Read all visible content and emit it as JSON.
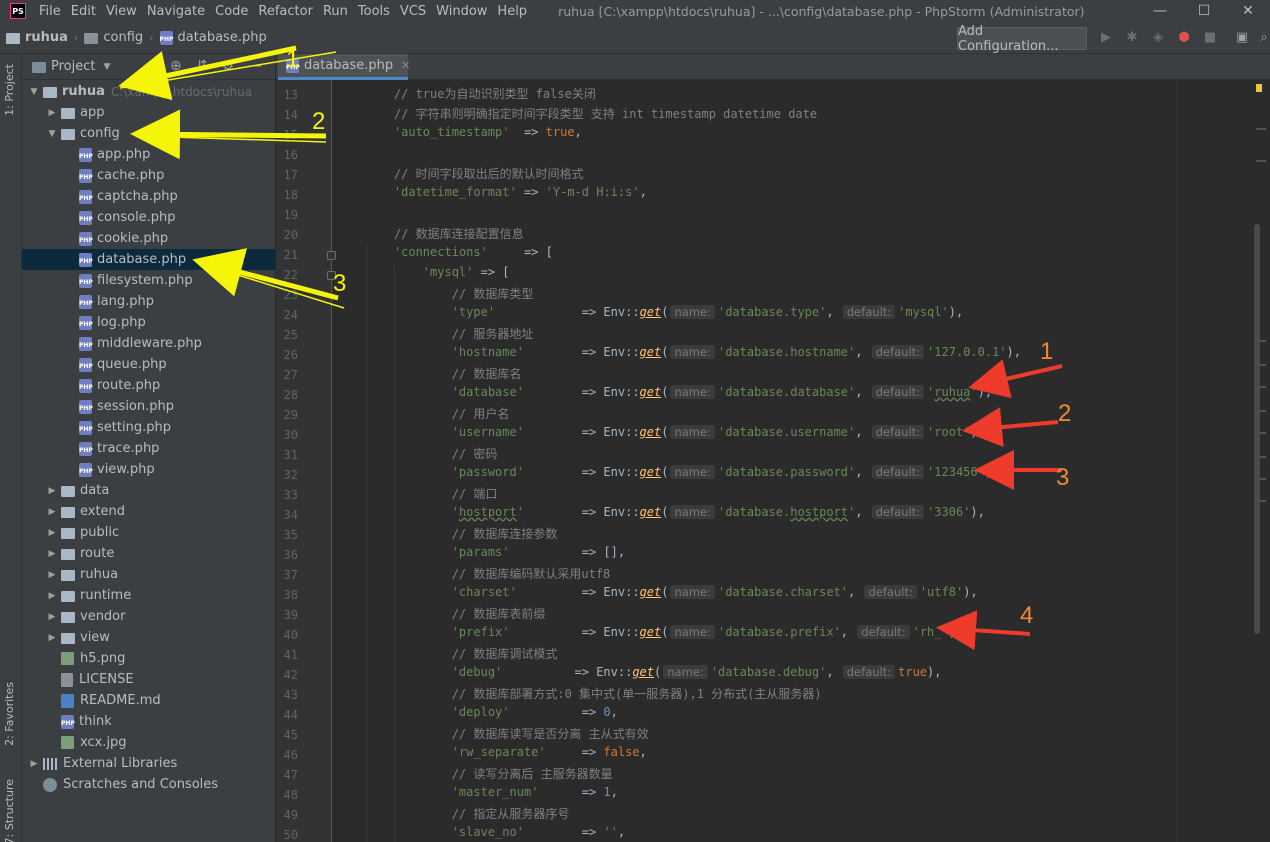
{
  "window": {
    "title": "ruhua [C:\\xampp\\htdocs\\ruhua] - ...\\config\\database.php - PhpStorm (Administrator)",
    "app_logo": "PS",
    "controls": [
      "—",
      "☐",
      "✕"
    ]
  },
  "menu": [
    "File",
    "Edit",
    "View",
    "Navigate",
    "Code",
    "Refactor",
    "Run",
    "Tools",
    "VCS",
    "Window",
    "Help"
  ],
  "breadcrumb": [
    "ruhua",
    "config",
    "database.php"
  ],
  "toolbar": {
    "add_configuration": "Add Configuration..."
  },
  "side_labels": {
    "project": "1: Project",
    "favorites": "2: Favorites",
    "structure": "7: Structure"
  },
  "project_panel": {
    "title": "Project",
    "tree": [
      {
        "label": "ruhua",
        "path": "C:\\xampp\\htdocs\\ruhua",
        "kind": "folder",
        "depth": 0,
        "expanded": true
      },
      {
        "label": "app",
        "kind": "folder",
        "depth": 1,
        "expanded": false
      },
      {
        "label": "config",
        "kind": "folder",
        "depth": 1,
        "expanded": true
      },
      {
        "label": "app.php",
        "kind": "php",
        "depth": 2
      },
      {
        "label": "cache.php",
        "kind": "php",
        "depth": 2
      },
      {
        "label": "captcha.php",
        "kind": "php",
        "depth": 2
      },
      {
        "label": "console.php",
        "kind": "php",
        "depth": 2
      },
      {
        "label": "cookie.php",
        "kind": "php",
        "depth": 2
      },
      {
        "label": "database.php",
        "kind": "php",
        "depth": 2,
        "selected": true
      },
      {
        "label": "filesystem.php",
        "kind": "php",
        "depth": 2
      },
      {
        "label": "lang.php",
        "kind": "php",
        "depth": 2
      },
      {
        "label": "log.php",
        "kind": "php",
        "depth": 2
      },
      {
        "label": "middleware.php",
        "kind": "php",
        "depth": 2
      },
      {
        "label": "queue.php",
        "kind": "php",
        "depth": 2
      },
      {
        "label": "route.php",
        "kind": "php",
        "depth": 2
      },
      {
        "label": "session.php",
        "kind": "php",
        "depth": 2
      },
      {
        "label": "setting.php",
        "kind": "php",
        "depth": 2
      },
      {
        "label": "trace.php",
        "kind": "php",
        "depth": 2
      },
      {
        "label": "view.php",
        "kind": "php",
        "depth": 2
      },
      {
        "label": "data",
        "kind": "folder",
        "depth": 1,
        "expanded": false
      },
      {
        "label": "extend",
        "kind": "folder",
        "depth": 1,
        "expanded": false
      },
      {
        "label": "public",
        "kind": "folder",
        "depth": 1,
        "expanded": false
      },
      {
        "label": "route",
        "kind": "folder",
        "depth": 1,
        "expanded": false
      },
      {
        "label": "ruhua",
        "kind": "folder",
        "depth": 1,
        "expanded": false
      },
      {
        "label": "runtime",
        "kind": "folder",
        "depth": 1,
        "expanded": false
      },
      {
        "label": "vendor",
        "kind": "folder",
        "depth": 1,
        "expanded": false
      },
      {
        "label": "view",
        "kind": "folder",
        "depth": 1,
        "expanded": false
      },
      {
        "label": "h5.png",
        "kind": "image",
        "depth": 1
      },
      {
        "label": "LICENSE",
        "kind": "file",
        "depth": 1
      },
      {
        "label": "README.md",
        "kind": "md",
        "depth": 1
      },
      {
        "label": "think",
        "kind": "php",
        "depth": 1
      },
      {
        "label": "xcx.jpg",
        "kind": "image",
        "depth": 1
      },
      {
        "label": "External Libraries",
        "kind": "lib",
        "depth": 0,
        "expanded": false
      },
      {
        "label": "Scratches and Consoles",
        "kind": "scratch",
        "depth": 0
      }
    ]
  },
  "editor": {
    "tab": "database.php",
    "first_line": 13,
    "lines": [
      "<i>    // true为自动识别类型 false关闭</i>",
      "<i>    // 字符串则明确指定时间字段类型 支持 int timestamp datetime date</i>",
      "    <s>'auto_timestamp'</s>  => <k>true</k>,",
      "",
      "<i>    // 时间字段取出后的默认时间格式</i>",
      "    <s>'datetime_format'</s> => <s>'Y-m-d H:i:s'</s>,",
      "",
      "<i>    // 数据库连接配置信息</i>",
      "    <s>'connections'</s>     => [",
      "        <s>'mysql'</s> => [",
      "<i>            // 数据库类型</i>",
      "            <s>'type'</s>            => Env::<g>get</g>(<h>name:</h><s>'database.type'</s>, <h>default:</h><s>'mysql'</s>),",
      "<i>            // 服务器地址</i>",
      "            <s>'hostname'</s>        => Env::<g>get</g>(<h>name:</h><s>'database.hostname'</s>, <h>default:</h><s>'127.0.0.1'</s>),",
      "<i>            // 数据库名</i>",
      "            <s>'database'</s>        => Env::<g>get</g>(<h>name:</h><s>'database.database'</s>, <h>default:</h><s>'<w>ruhua</w>'</s>),",
      "<i>            // 用户名</i>",
      "            <s>'username'</s>        => Env::<g>get</g>(<h>name:</h><s>'database.username'</s>, <h>default:</h><s>'root'</s>),",
      "<i>            // 密码</i>",
      "            <s>'password'</s>        => Env::<g>get</g>(<h>name:</h><s>'database.password'</s>, <h>default:</h><s>'123456'</s>),",
      "<i>            // 端口</i>",
      "            <s>'<w>hostport</w>'</s>        => Env::<g>get</g>(<h>name:</h><s>'database.<w>hostport</w>'</s>, <h>default:</h><s>'3306'</s>),",
      "<i>            // 数据库连接参数</i>",
      "            <s>'params'</s>          => [],",
      "<i>            // 数据库编码默认采用utf8</i>",
      "            <s>'charset'</s>         => Env::<g>get</g>(<h>name:</h><s>'database.charset'</s>, <h>default:</h><s>'utf8'</s>),",
      "<i>            // 数据库表前缀</i>",
      "            <s>'prefix'</s>          => Env::<g>get</g>(<h>name:</h><s>'database.prefix'</s>, <h>default:</h><s>'rh_'</s>),",
      "<i>            // 数据库调试模式</i>",
      "            <s>'debug'</s>          => Env::<g>get</g>(<h>name:</h><s>'database.debug'</s>, <h>default:</h><k>true</k>),",
      "<i>            // 数据库部署方式:0 集中式(单一服务器),1 分布式(主从服务器)</i>",
      "            <s>'deploy'</s>          => <n>0</n>,",
      "<i>            // 数据库读写是否分离 主从式有效</i>",
      "            <s>'rw_separate'</s>     => <k>false</k>,",
      "<i>            // 读写分离后 主服务器数量</i>",
      "            <s>'master_num'</s>      => <n>1</n>,",
      "<i>            // 指定从服务器序号</i>",
      "            <s>'slave_no'</s>        => <s>''</s>,"
    ]
  },
  "annotations": {
    "yellow": [
      "1",
      "2",
      "3"
    ],
    "red": [
      "1",
      "2",
      "3",
      "4"
    ],
    "yellow_color": "#f5f50a",
    "red_color": "#ef3b2c",
    "red_num_color": "#f08a32"
  }
}
